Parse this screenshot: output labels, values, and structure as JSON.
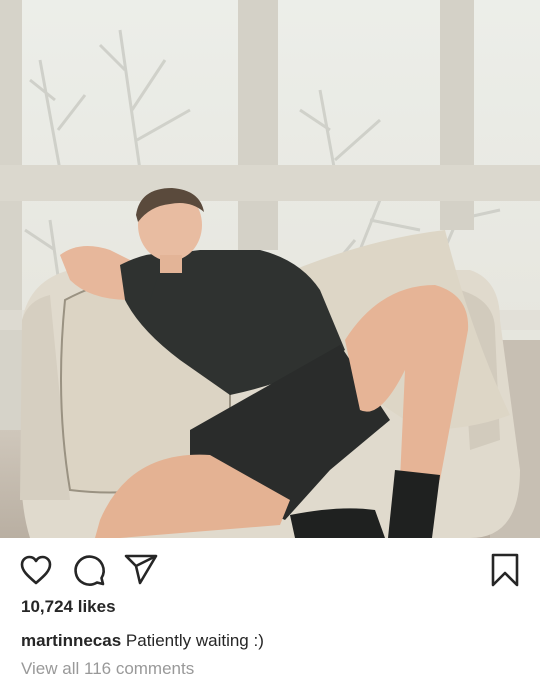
{
  "post": {
    "photo_alt": "",
    "likes_text": "10,724 likes",
    "caption": {
      "username": "martinnecas",
      "text": "Patiently waiting :)"
    },
    "view_comments_text": "View all 116 comments"
  },
  "icons": {
    "like": "heart-icon",
    "comment": "comment-bubble-icon",
    "share": "paper-plane-icon",
    "save": "bookmark-icon"
  },
  "colors": {
    "text": "#262626",
    "secondary_text": "#999999",
    "background": "#ffffff"
  }
}
